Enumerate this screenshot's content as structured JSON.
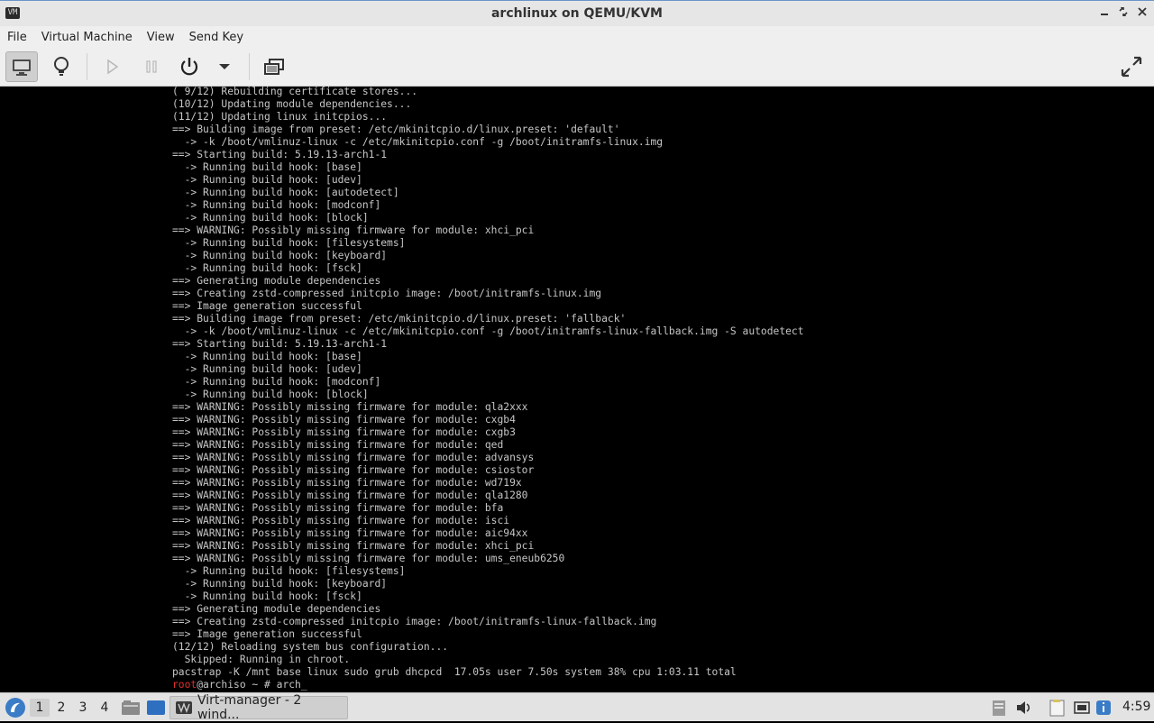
{
  "window": {
    "title": "archlinux on QEMU/KVM",
    "app_icon_text": "VM"
  },
  "menubar": {
    "items": [
      "File",
      "Virtual Machine",
      "View",
      "Send Key"
    ]
  },
  "console": {
    "lines": [
      "( 9/12) Rebuilding certificate stores...",
      "(10/12) Updating module dependencies...",
      "(11/12) Updating linux initcpios...",
      "==> Building image from preset: /etc/mkinitcpio.d/linux.preset: 'default'",
      "  -> -k /boot/vmlinuz-linux -c /etc/mkinitcpio.conf -g /boot/initramfs-linux.img",
      "==> Starting build: 5.19.13-arch1-1",
      "  -> Running build hook: [base]",
      "  -> Running build hook: [udev]",
      "  -> Running build hook: [autodetect]",
      "  -> Running build hook: [modconf]",
      "  -> Running build hook: [block]",
      "==> WARNING: Possibly missing firmware for module: xhci_pci",
      "  -> Running build hook: [filesystems]",
      "  -> Running build hook: [keyboard]",
      "  -> Running build hook: [fsck]",
      "==> Generating module dependencies",
      "==> Creating zstd-compressed initcpio image: /boot/initramfs-linux.img",
      "==> Image generation successful",
      "==> Building image from preset: /etc/mkinitcpio.d/linux.preset: 'fallback'",
      "  -> -k /boot/vmlinuz-linux -c /etc/mkinitcpio.conf -g /boot/initramfs-linux-fallback.img -S autodetect",
      "==> Starting build: 5.19.13-arch1-1",
      "  -> Running build hook: [base]",
      "  -> Running build hook: [udev]",
      "  -> Running build hook: [modconf]",
      "  -> Running build hook: [block]",
      "==> WARNING: Possibly missing firmware for module: qla2xxx",
      "==> WARNING: Possibly missing firmware for module: cxgb4",
      "==> WARNING: Possibly missing firmware for module: cxgb3",
      "==> WARNING: Possibly missing firmware for module: qed",
      "==> WARNING: Possibly missing firmware for module: advansys",
      "==> WARNING: Possibly missing firmware for module: csiostor",
      "==> WARNING: Possibly missing firmware for module: wd719x",
      "==> WARNING: Possibly missing firmware for module: qla1280",
      "==> WARNING: Possibly missing firmware for module: bfa",
      "==> WARNING: Possibly missing firmware for module: isci",
      "==> WARNING: Possibly missing firmware for module: aic94xx",
      "==> WARNING: Possibly missing firmware for module: xhci_pci",
      "==> WARNING: Possibly missing firmware for module: ums_eneub6250",
      "  -> Running build hook: [filesystems]",
      "  -> Running build hook: [keyboard]",
      "  -> Running build hook: [fsck]",
      "==> Generating module dependencies",
      "==> Creating zstd-compressed initcpio image: /boot/initramfs-linux-fallback.img",
      "==> Image generation successful",
      "(12/12) Reloading system bus configuration...",
      "  Skipped: Running in chroot.",
      "pacstrap -K /mnt base linux sudo grub dhcpcd  17.05s user 7.50s system 38% cpu 1:03.11 total"
    ],
    "prompt": {
      "user": "root",
      "rest": "@archiso ~ # ",
      "input": "arch",
      "cursor": "_"
    }
  },
  "taskbar": {
    "workspaces": [
      "1",
      "2",
      "3",
      "4"
    ],
    "active_workspace": "1",
    "task_label": "Virt-manager - 2 wind...",
    "clock": "4:59"
  },
  "colors": {
    "accent": "#6a96c8",
    "prompt_user": "#e03030",
    "console_text": "#c6c6c6"
  }
}
